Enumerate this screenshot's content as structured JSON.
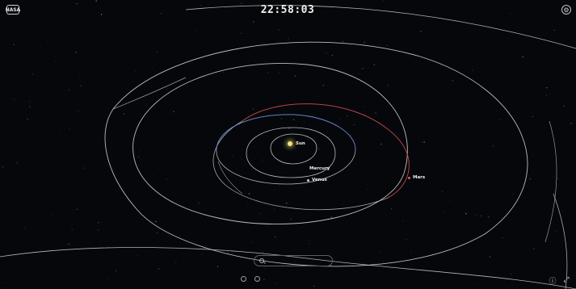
{
  "app": {
    "logo_text": "NASA"
  },
  "header": {
    "clock": "22:58:03"
  },
  "hud": {
    "settings_icon": "gear-icon",
    "expand_icon": "fullscreen-icon",
    "info_icon": "info-icon"
  },
  "sun": {
    "label": "Sun"
  },
  "planets": {
    "mercury": "Mercury",
    "venus": "Venus",
    "mars": "Mars"
  },
  "colors": {
    "orbit": "#d6d8dc",
    "mars_orbit": "#c94a4a",
    "earth_orbit": "#6a8fd6",
    "sun": "#f6e27a"
  }
}
